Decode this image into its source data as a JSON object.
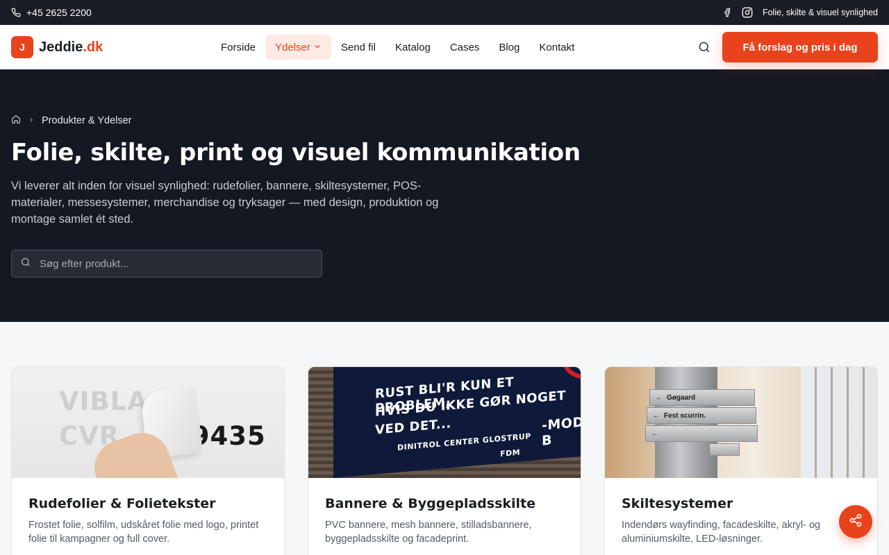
{
  "topbar": {
    "phone": "+45 2625 2200",
    "tagline": "Folie, skilte & visuel synlighed",
    "icons": [
      "phone-icon",
      "facebook-icon",
      "instagram-icon"
    ]
  },
  "brand": {
    "badge": "J",
    "name": "Jeddie",
    "tld": ".dk",
    "accent": "#e8431c"
  },
  "nav": {
    "items": [
      {
        "label": "Forside"
      },
      {
        "label": "Ydelser",
        "active": true
      },
      {
        "label": "Send fil"
      },
      {
        "label": "Katalog"
      },
      {
        "label": "Cases"
      },
      {
        "label": "Blog"
      },
      {
        "label": "Kontakt"
      }
    ],
    "cta": "Få forslag og pris i dag"
  },
  "hero": {
    "breadcrumb": "Produkter & Ydelser",
    "title": "Folie, skilte, print og visuel kommunikation",
    "description": "Vi leverer alt inden for visuel synlighed: rudefolier, bannere, skiltesystemer, POS-materialer, messesystemer, merchandise og tryksager — med design, produktion og montage samlet ét sted.",
    "search_placeholder": "Søg efter produkt..."
  },
  "cards": [
    {
      "title": "Rudefolier & Folietekster",
      "description": "Frostet folie, solfilm, udskåret folie med logo, printet folie til kampagner og full cover.",
      "image_text": {
        "line1": "VIBLA",
        "line2": "CVR",
        "number": "29435"
      }
    },
    {
      "title": "Bannere & Byggepladsskilte",
      "description": "PVC bannere, mesh bannere, stilladsbannere, byggepladsskilte og facadeprint.",
      "image_text": {
        "line1": "RUST BLI'R KUN ET PROBLEM,",
        "line2": "HVIS DU IKKE GØR NOGET",
        "line3": "VED DET...",
        "line4": "DINITROL CENTER GLOSTRUP",
        "side": "-MOD B",
        "logo": "FDM"
      }
    },
    {
      "title": "Skiltesystemer",
      "description": "Indendørs wayfinding, facadeskilte, akryl- og aluminiumskilte, LED-løsninger.",
      "image_text": {
        "sign1": "Gøgaard",
        "sign2": "Fest scurrin."
      }
    }
  ]
}
